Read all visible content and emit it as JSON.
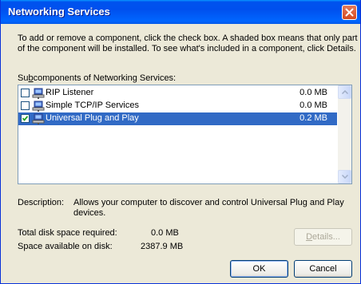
{
  "window": {
    "title": "Networking Services"
  },
  "intro": {
    "line1": "To add or remove a component, click the check box. A shaded box means that only part",
    "line2": "of the component will be installed. To see what's included in a component, click Details."
  },
  "subcomponents_label_pre": "Su",
  "subcomponents_label_acc": "b",
  "subcomponents_label_post": "components of Networking Services:",
  "components": [
    {
      "name": "RIP Listener",
      "size": "0.0 MB",
      "checked": false
    },
    {
      "name": "Simple TCP/IP Services",
      "size": "0.0 MB",
      "checked": false
    },
    {
      "name": "Universal Plug and Play",
      "size": "0.2 MB",
      "checked": true,
      "selected": true
    }
  ],
  "description": {
    "label": "Description:",
    "line1": "Allows your computer to discover and control Universal Plug and Play",
    "line2": "devices."
  },
  "disk": {
    "required_label": "Total disk space required:",
    "required_value": "0.0 MB",
    "available_label": "Space available on disk:",
    "available_value": "2387.9 MB"
  },
  "buttons": {
    "details_acc": "D",
    "details_rest": "etails...",
    "ok": "OK",
    "cancel": "Cancel"
  },
  "colors": {
    "titlebar": "#0055ea",
    "selection": "#316ac5",
    "window": "#ece9d8"
  }
}
